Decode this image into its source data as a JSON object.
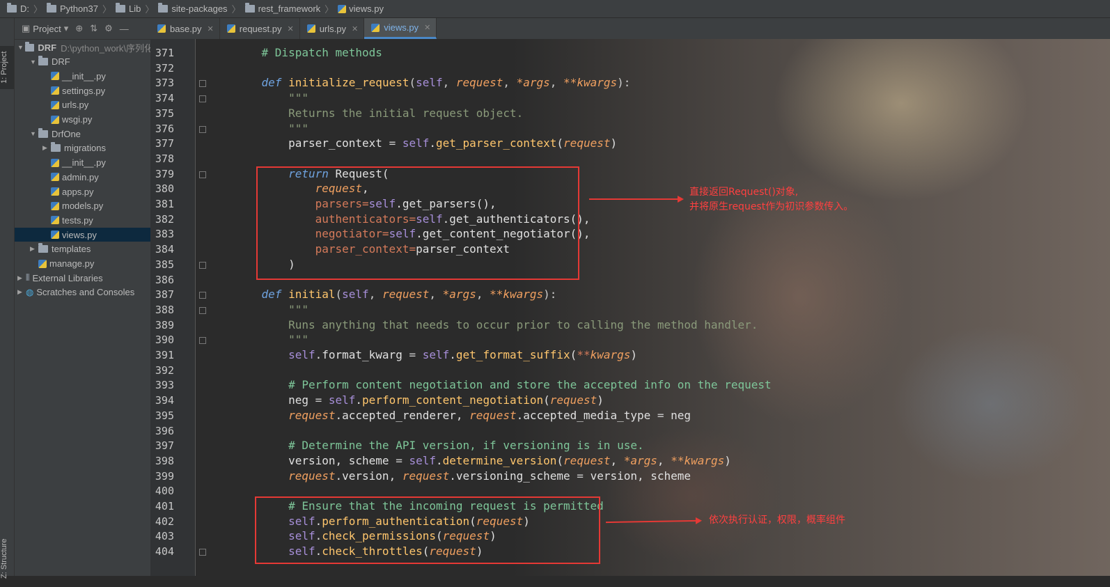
{
  "breadcrumb": [
    "D:",
    "Python37",
    "Lib",
    "site-packages",
    "rest_framework",
    "views.py"
  ],
  "tool_windows": {
    "project": "1: Project",
    "structure": "Z: Structure"
  },
  "project_panel": {
    "title": "Project",
    "tree": [
      {
        "label": "DRF",
        "path": "D:\\python_work\\序列化",
        "depth": 0,
        "type": "folder",
        "expanded": true
      },
      {
        "label": "DRF",
        "depth": 1,
        "type": "folder",
        "expanded": true
      },
      {
        "label": "__init__.py",
        "depth": 2,
        "type": "py"
      },
      {
        "label": "settings.py",
        "depth": 2,
        "type": "py"
      },
      {
        "label": "urls.py",
        "depth": 2,
        "type": "py"
      },
      {
        "label": "wsgi.py",
        "depth": 2,
        "type": "py"
      },
      {
        "label": "DrfOne",
        "depth": 1,
        "type": "folder",
        "expanded": true
      },
      {
        "label": "migrations",
        "depth": 2,
        "type": "folder",
        "expanded": false
      },
      {
        "label": "__init__.py",
        "depth": 2,
        "type": "py"
      },
      {
        "label": "admin.py",
        "depth": 2,
        "type": "py"
      },
      {
        "label": "apps.py",
        "depth": 2,
        "type": "py"
      },
      {
        "label": "models.py",
        "depth": 2,
        "type": "py"
      },
      {
        "label": "tests.py",
        "depth": 2,
        "type": "py"
      },
      {
        "label": "views.py",
        "depth": 2,
        "type": "py",
        "selected": true
      },
      {
        "label": "templates",
        "depth": 1,
        "type": "folder",
        "expanded": false
      },
      {
        "label": "manage.py",
        "depth": 1,
        "type": "py"
      },
      {
        "label": "External Libraries",
        "depth": 0,
        "type": "lib",
        "expanded": false
      },
      {
        "label": "Scratches and Consoles",
        "depth": 0,
        "type": "scratch",
        "expanded": false
      }
    ]
  },
  "editor_tabs": [
    {
      "label": "base.py",
      "active": false
    },
    {
      "label": "request.py",
      "active": false
    },
    {
      "label": "urls.py",
      "active": false
    },
    {
      "label": "views.py",
      "active": true
    }
  ],
  "code": {
    "first_line": 371,
    "lines": [
      [
        [
          "    # Dispatch methods",
          "cmt"
        ]
      ],
      [],
      [
        [
          "    ",
          ""
        ],
        [
          "def",
          "kw"
        ],
        [
          " ",
          ""
        ],
        [
          "initialize_request",
          "fn"
        ],
        [
          "(",
          "op"
        ],
        [
          "self",
          "selfc"
        ],
        [
          ", ",
          "op"
        ],
        [
          "request",
          "par"
        ],
        [
          ", ",
          "op"
        ],
        [
          "*args",
          "par"
        ],
        [
          ", ",
          "op"
        ],
        [
          "**kwargs",
          "par"
        ],
        [
          "):",
          "op"
        ]
      ],
      [
        [
          "        \"\"\"",
          "doc"
        ]
      ],
      [
        [
          "        Returns the initial request object.",
          "doc"
        ]
      ],
      [
        [
          "        \"\"\"",
          "doc"
        ]
      ],
      [
        [
          "        parser_context ",
          ""
        ],
        [
          "=",
          "op"
        ],
        [
          " ",
          ""
        ],
        [
          "self",
          "selfc"
        ],
        [
          ".",
          ""
        ],
        [
          "get_parser_context",
          "fn"
        ],
        [
          "(",
          ""
        ],
        [
          "request",
          "par"
        ],
        [
          ")",
          ""
        ]
      ],
      [],
      [
        [
          "        ",
          ""
        ],
        [
          "return",
          "kw"
        ],
        [
          " Request(",
          ""
        ]
      ],
      [
        [
          "            ",
          ""
        ],
        [
          "request",
          "par"
        ],
        [
          ",",
          ""
        ]
      ],
      [
        [
          "            ",
          ""
        ],
        [
          "parsers=",
          "kwarg"
        ],
        [
          "self",
          "selfc"
        ],
        [
          ".get_parsers(),",
          ""
        ]
      ],
      [
        [
          "            ",
          ""
        ],
        [
          "authenticators=",
          "kwarg"
        ],
        [
          "self",
          "selfc"
        ],
        [
          ".get_authenticators(),",
          ""
        ]
      ],
      [
        [
          "            ",
          ""
        ],
        [
          "negotiator=",
          "kwarg"
        ],
        [
          "self",
          "selfc"
        ],
        [
          ".get_content_negotiator(),",
          ""
        ]
      ],
      [
        [
          "            ",
          ""
        ],
        [
          "parser_context=",
          "kwarg"
        ],
        [
          "parser_context",
          ""
        ]
      ],
      [
        [
          "        )",
          ""
        ]
      ],
      [],
      [
        [
          "    ",
          ""
        ],
        [
          "def",
          "kw"
        ],
        [
          " ",
          ""
        ],
        [
          "initial",
          "fn"
        ],
        [
          "(",
          "op"
        ],
        [
          "self",
          "selfc"
        ],
        [
          ", ",
          "op"
        ],
        [
          "request",
          "par"
        ],
        [
          ", ",
          "op"
        ],
        [
          "*args",
          "par"
        ],
        [
          ", ",
          "op"
        ],
        [
          "**kwargs",
          "par"
        ],
        [
          "):",
          "op"
        ]
      ],
      [
        [
          "        \"\"\"",
          "doc"
        ]
      ],
      [
        [
          "        Runs anything that needs to occur prior to calling the method handler.",
          "doc"
        ]
      ],
      [
        [
          "        \"\"\"",
          "doc"
        ]
      ],
      [
        [
          "        ",
          ""
        ],
        [
          "self",
          "selfc"
        ],
        [
          ".format_kwarg ",
          ""
        ],
        [
          "=",
          "op"
        ],
        [
          " ",
          ""
        ],
        [
          "self",
          "selfc"
        ],
        [
          ".",
          ""
        ],
        [
          "get_format_suffix",
          "fn"
        ],
        [
          "(",
          ""
        ],
        [
          "**",
          "kwarg"
        ],
        [
          "kwargs",
          "par"
        ],
        [
          ")",
          ""
        ]
      ],
      [],
      [
        [
          "        # Perform content negotiation and store the accepted info on the request",
          "cmt"
        ]
      ],
      [
        [
          "        neg ",
          ""
        ],
        [
          "=",
          "op"
        ],
        [
          " ",
          ""
        ],
        [
          "self",
          "selfc"
        ],
        [
          ".",
          ""
        ],
        [
          "perform_content_negotiation",
          "fn"
        ],
        [
          "(",
          ""
        ],
        [
          "request",
          "par"
        ],
        [
          ")",
          ""
        ]
      ],
      [
        [
          "        ",
          ""
        ],
        [
          "request",
          "par"
        ],
        [
          ".accepted_renderer, ",
          ""
        ],
        [
          "request",
          "par"
        ],
        [
          ".accepted_media_type ",
          ""
        ],
        [
          "=",
          "op"
        ],
        [
          " neg",
          ""
        ]
      ],
      [],
      [
        [
          "        # Determine the API version, if versioning is in use.",
          "cmt"
        ]
      ],
      [
        [
          "        version, scheme ",
          ""
        ],
        [
          "=",
          "op"
        ],
        [
          " ",
          ""
        ],
        [
          "self",
          "selfc"
        ],
        [
          ".",
          ""
        ],
        [
          "determine_version",
          "fn"
        ],
        [
          "(",
          ""
        ],
        [
          "request",
          "par"
        ],
        [
          ", ",
          ""
        ],
        [
          "*args",
          "par"
        ],
        [
          ", ",
          ""
        ],
        [
          "**kwargs",
          "par"
        ],
        [
          ")",
          ""
        ]
      ],
      [
        [
          "        ",
          ""
        ],
        [
          "request",
          "par"
        ],
        [
          ".version, ",
          ""
        ],
        [
          "request",
          "par"
        ],
        [
          ".versioning_scheme ",
          ""
        ],
        [
          "=",
          "op"
        ],
        [
          " version, scheme",
          ""
        ]
      ],
      [],
      [
        [
          "        # Ensure that the incoming request is permitted",
          "cmt"
        ]
      ],
      [
        [
          "        ",
          ""
        ],
        [
          "self",
          "selfc"
        ],
        [
          ".",
          ""
        ],
        [
          "perform_authentication",
          "fn"
        ],
        [
          "(",
          ""
        ],
        [
          "request",
          "par"
        ],
        [
          ")",
          ""
        ]
      ],
      [
        [
          "        ",
          ""
        ],
        [
          "self",
          "selfc"
        ],
        [
          ".",
          ""
        ],
        [
          "check_permissions",
          "fn"
        ],
        [
          "(",
          ""
        ],
        [
          "request",
          "par"
        ],
        [
          ")",
          ""
        ]
      ],
      [
        [
          "        ",
          ""
        ],
        [
          "self",
          "selfc"
        ],
        [
          ".",
          ""
        ],
        [
          "check_throttles",
          "fn"
        ],
        [
          "(",
          ""
        ],
        [
          "request",
          "par"
        ],
        [
          ")",
          ""
        ]
      ]
    ]
  },
  "annotations": [
    {
      "text": "直接返回Request()对象,\n并将原生request作为初识参数传入。",
      "color": "#e53935"
    },
    {
      "text": "依次执行认证，权限，概率组件",
      "color": "#e53935"
    }
  ]
}
